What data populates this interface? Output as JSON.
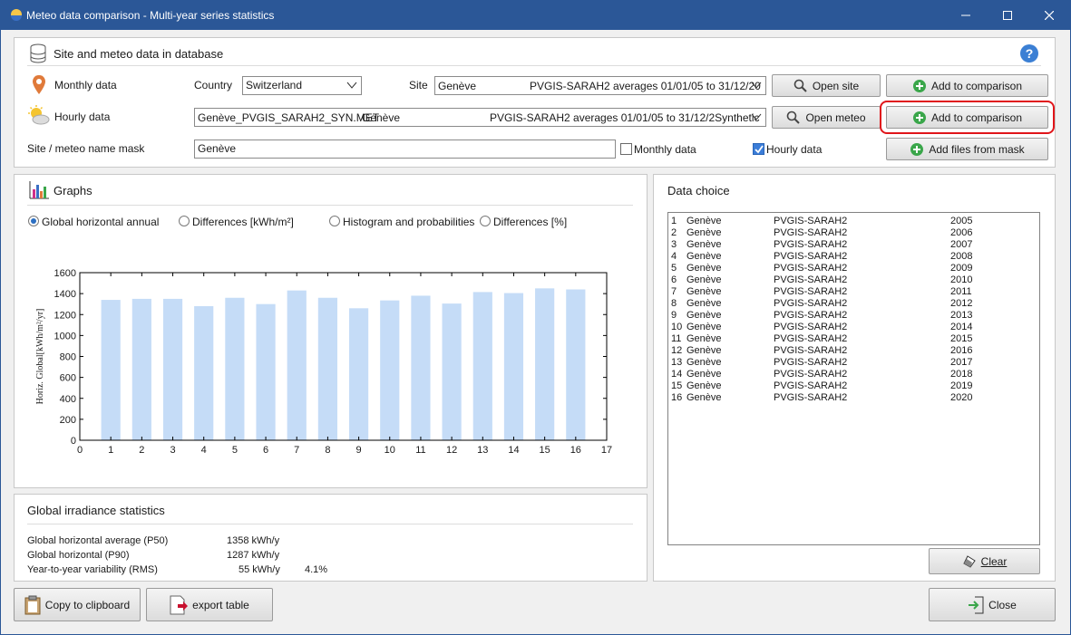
{
  "window": {
    "title": "Meteo data comparison - Multi-year series statistics"
  },
  "header": {
    "title": "Site and meteo data in database"
  },
  "monthly": {
    "label": "Monthly data",
    "country_label": "Country",
    "country_value": "Switzerland",
    "site_label": "Site",
    "site_name": "Genève",
    "site_desc": "PVGIS-SARAH2 averages 01/01/05 to 31/12/20",
    "open_label": "Open site",
    "add_label": "Add to comparison"
  },
  "hourly": {
    "label": "Hourly data",
    "file": "Genève_PVGIS_SARAH2_SYN.MET",
    "site": "Genève",
    "desc": "PVGIS-SARAH2 averages 01/01/05 to 31/12/2Synthetic",
    "open_label": "Open meteo",
    "add_label": "Add to comparison"
  },
  "mask": {
    "label": "Site / meteo name mask",
    "value": "Genève",
    "monthly_chk": "Monthly data",
    "hourly_chk": "Hourly data",
    "add_files_label": "Add files from mask"
  },
  "graphs": {
    "title": "Graphs",
    "options": [
      "Global horizontal annual",
      "Differences [kWh/m²]",
      "Histogram and probabilities",
      "Differences [%]"
    ],
    "selected": 0
  },
  "chart_data": {
    "type": "bar",
    "categories": [
      "1",
      "2",
      "3",
      "4",
      "5",
      "6",
      "7",
      "8",
      "9",
      "10",
      "11",
      "12",
      "13",
      "14",
      "15",
      "16"
    ],
    "values": [
      1340,
      1350,
      1350,
      1280,
      1360,
      1300,
      1430,
      1360,
      1260,
      1335,
      1380,
      1305,
      1415,
      1405,
      1450,
      1440
    ],
    "ylabel": "Horiz. Global[kWh/m²/yr]",
    "xlabel": "",
    "xlim": [
      0,
      17
    ],
    "ylim": [
      0,
      1600
    ],
    "xticks": [
      "0",
      "1",
      "2",
      "3",
      "4",
      "5",
      "6",
      "7",
      "8",
      "9",
      "10",
      "11",
      "12",
      "13",
      "14",
      "15",
      "16",
      "17"
    ],
    "yticks": [
      "0",
      "200",
      "400",
      "600",
      "800",
      "1000",
      "1200",
      "1400",
      "1600"
    ],
    "bar_color": "#c5dcf7"
  },
  "data_choice": {
    "title": "Data choice",
    "rows": [
      {
        "n": "1",
        "site": "Genève",
        "src": "PVGIS-SARAH2",
        "year": "2005"
      },
      {
        "n": "2",
        "site": "Genève",
        "src": "PVGIS-SARAH2",
        "year": "2006"
      },
      {
        "n": "3",
        "site": "Genève",
        "src": "PVGIS-SARAH2",
        "year": "2007"
      },
      {
        "n": "4",
        "site": "Genève",
        "src": "PVGIS-SARAH2",
        "year": "2008"
      },
      {
        "n": "5",
        "site": "Genève",
        "src": "PVGIS-SARAH2",
        "year": "2009"
      },
      {
        "n": "6",
        "site": "Genève",
        "src": "PVGIS-SARAH2",
        "year": "2010"
      },
      {
        "n": "7",
        "site": "Genève",
        "src": "PVGIS-SARAH2",
        "year": "2011"
      },
      {
        "n": "8",
        "site": "Genève",
        "src": "PVGIS-SARAH2",
        "year": "2012"
      },
      {
        "n": "9",
        "site": "Genève",
        "src": "PVGIS-SARAH2",
        "year": "2013"
      },
      {
        "n": "10",
        "site": "Genève",
        "src": "PVGIS-SARAH2",
        "year": "2014"
      },
      {
        "n": "11",
        "site": "Genève",
        "src": "PVGIS-SARAH2",
        "year": "2015"
      },
      {
        "n": "12",
        "site": "Genève",
        "src": "PVGIS-SARAH2",
        "year": "2016"
      },
      {
        "n": "13",
        "site": "Genève",
        "src": "PVGIS-SARAH2",
        "year": "2017"
      },
      {
        "n": "14",
        "site": "Genève",
        "src": "PVGIS-SARAH2",
        "year": "2018"
      },
      {
        "n": "15",
        "site": "Genève",
        "src": "PVGIS-SARAH2",
        "year": "2019"
      },
      {
        "n": "16",
        "site": "Genève",
        "src": "PVGIS-SARAH2",
        "year": "2020"
      }
    ],
    "clear_label": "Clear"
  },
  "stats": {
    "title": "Global irradiance statistics",
    "p50_label": "Global horizontal average (P50)",
    "p50_value": "1358 kWh/y",
    "p90_label": "Global horizontal (P90)",
    "p90_value": "1287 kWh/y",
    "rms_label": "Year-to-year variability (RMS)",
    "rms_value": "55 kWh/y",
    "rms_pct": "4.1%"
  },
  "footer": {
    "copy_label": "Copy to clipboard",
    "export_label": "export table",
    "close_label": "Close"
  },
  "colors": {
    "titlebar": "#2b5797",
    "accent_red": "#e0151a",
    "add_green": "#3aa64a"
  }
}
